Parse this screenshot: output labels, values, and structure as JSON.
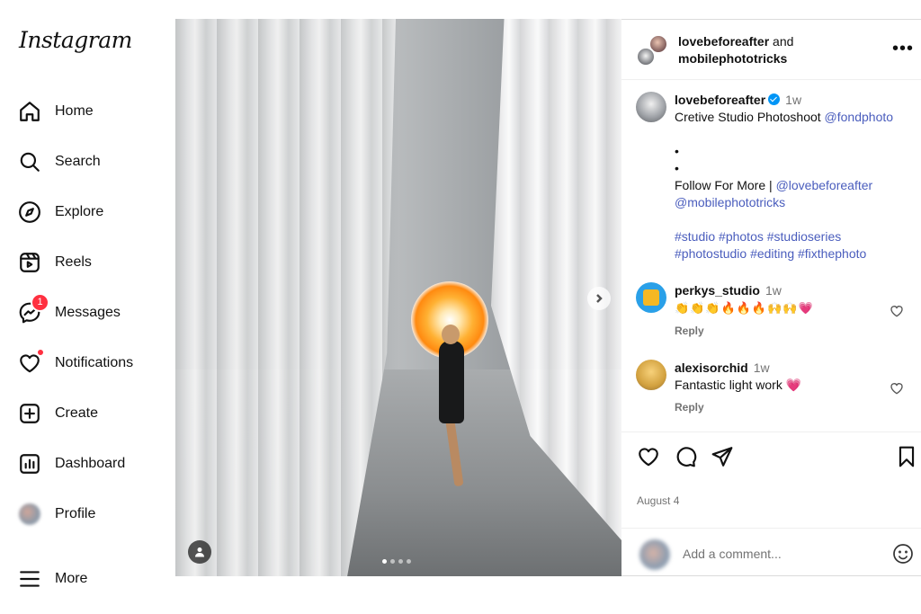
{
  "sidebar": {
    "logo": "Instagram",
    "items": [
      {
        "label": "Home",
        "icon": "home-icon"
      },
      {
        "label": "Search",
        "icon": "search-icon"
      },
      {
        "label": "Explore",
        "icon": "compass-icon"
      },
      {
        "label": "Reels",
        "icon": "reels-icon"
      },
      {
        "label": "Messages",
        "icon": "messenger-icon",
        "badge": "1"
      },
      {
        "label": "Notifications",
        "icon": "heart-icon"
      },
      {
        "label": "Create",
        "icon": "plus-square-icon"
      },
      {
        "label": "Dashboard",
        "icon": "dashboard-icon"
      },
      {
        "label": "Profile",
        "icon": "avatar"
      },
      {
        "label": "More",
        "icon": "menu-icon"
      }
    ]
  },
  "post": {
    "carousel_total": 4,
    "carousel_active": 1
  },
  "panel": {
    "header": {
      "author1": "lovebeforeafter",
      "and": "and",
      "author2": "mobilephototricks"
    },
    "caption": {
      "username": "lovebeforeafter",
      "time": "1w",
      "line1": "Cretive Studio Photoshoot",
      "mention1": "@fondphoto",
      "dot1": "•",
      "dot2": "•",
      "follow_text": "Follow For More |",
      "mention2": "@lovebeforeafter",
      "mention3": "@mobilephototricks",
      "hashtags1": "#studio #photos #studioseries",
      "hashtags2": "#photostudio #editing #fixthephoto"
    },
    "comments": [
      {
        "username": "perkys_studio",
        "time": "1w",
        "text": "👏👏👏🔥🔥🔥🙌🙌💗",
        "reply": "Reply"
      },
      {
        "username": "alexisorchid",
        "time": "1w",
        "text": "Fantastic light work 💗",
        "reply": "Reply"
      }
    ],
    "date": "August 4",
    "comment_placeholder": "Add a comment..."
  },
  "colors": {
    "link": "#4a5dbd",
    "badge": "#ff3040",
    "verified": "#0095f6"
  }
}
